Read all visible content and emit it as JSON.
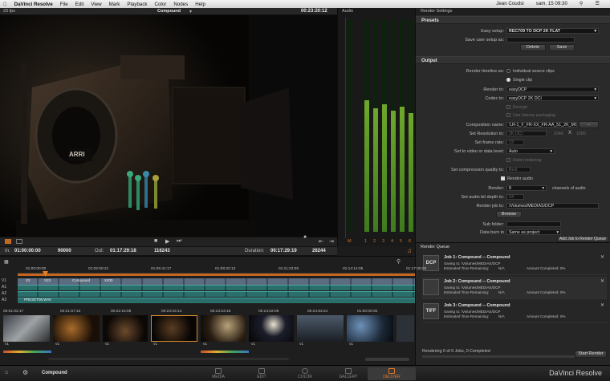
{
  "menubar": {
    "app": "DaVinci Resolve",
    "items": [
      "File",
      "Edit",
      "View",
      "Mark",
      "Playback",
      "Color",
      "Nodes",
      "Help"
    ],
    "user": "Jean Coudsi",
    "clock": "sam. 15 09:30"
  },
  "viewer": {
    "fps": "23 fps",
    "clip_name": "Compound",
    "timecode": "00:23:20:12"
  },
  "tcbar": {
    "in_label": "In:",
    "in_tc": "01:00:00:00",
    "in_frames": "90000",
    "out_label": "Out:",
    "out_tc": "01:17:29:18",
    "out_frames": "116243",
    "dur_label": "Duration:",
    "dur_tc": "00:17:29:19",
    "dur_frames": "26244"
  },
  "audio": {
    "title": "Audio",
    "levels": [
      0.62,
      0.58,
      0.6,
      0.57,
      0.59,
      0.56
    ],
    "channel_labels": [
      "M",
      "1",
      "2",
      "3",
      "4",
      "5",
      "6"
    ]
  },
  "render_settings": {
    "title": "Render Settings",
    "presets_header": "Presets",
    "easy_setup_label": "Easy setup:",
    "easy_setup_value": "REC709 TO DCP 2K FLAT",
    "save_user_label": "Save user setup as:",
    "delete_label": "Delete",
    "save_label": "Save",
    "output_header": "Output",
    "render_timeline_label": "Render timeline as:",
    "individual_clips": "Individual source clips",
    "single_clip": "Single clip",
    "render_to_label": "Render to:",
    "render_to_value": "easyDCP",
    "codec_label": "Codec to:",
    "codec_value": "easyDCP 2K DCI",
    "encrypt": "Encrypt",
    "interop": "Use Interop packaging",
    "comp_name_label": "Composition name:",
    "comp_name_value": "'LR-1_F_FR-XX_FR-AA_51_2K_MOM_CE",
    "browse_dots": "...",
    "resolution_label": "Set Resolution to:",
    "resolution_value": "2K DCI",
    "res_w": "2048",
    "res_x": "X",
    "res_h": "1080",
    "frame_rate_label": "Set frame rate:",
    "frame_rate_value": "23",
    "video_level_label": "Set to video or data level:",
    "video_level_value": "Auto",
    "field_rendering": "Field rendering",
    "compression_label": "Set compression quality to:",
    "compression_value": "Best",
    "render_audio": "Render audio",
    "render_label": "Render:",
    "render_channels": "8",
    "channels_of_audio": "channels of audio",
    "bit_depth_label": "Set audio bit depth to:",
    "bit_depth_value": "24",
    "render_job_label": "Render job to:",
    "render_job_value": "/Volumes/MEDIAS/DCP",
    "browse_label": "Browse",
    "subfolder_label": "Sub folder:",
    "data_burn_label": "Data burn in",
    "data_burn_value": "Same as project",
    "add_job": "Add Job to Render Queue"
  },
  "render_queue": {
    "title": "Render Queue",
    "jobs": [
      {
        "icon": "DCP",
        "title": "Job 1: Compound -- Compound",
        "saving": "Saving to: /Volumes/MEDIAS/DCP",
        "etr": "Estimated Time Remaining:",
        "etr_val": "N/A",
        "amount": "Amount Completed: 0%"
      },
      {
        "icon": "",
        "title": "Job 2: Compound -- Compound",
        "saving": "Saving to: /Volumes/MEDIAS/DCP",
        "etr": "Estimated Time Remaining:",
        "etr_val": "N/A",
        "amount": "Amount Completed: 0%"
      },
      {
        "icon": "TIFF",
        "title": "Job 3: Compound -- Compound",
        "saving": "Saving to: /Volumes/MEDIAS/DCP",
        "etr": "Estimated Time Remaining:",
        "etr_val": "N/A",
        "amount": "Amount Completed: 0%"
      }
    ],
    "status": "Rendering 0 of 0 Jobs, 0 Completed",
    "start_label": "Start Render"
  },
  "timeline": {
    "ruler": [
      "01:00:00:00",
      "01:02:50:21",
      "01:05:41:17",
      "01:08:32:13",
      "01:11:23:09",
      "01:14:14:05",
      "01:17:05:00"
    ],
    "tracks": [
      "V1",
      "A1",
      "A2",
      "A3"
    ],
    "audio_clip": "PRESET06.WAV",
    "clip_tcs": [
      "00:01:02:17",
      "00:21:57:10",
      "00:22:15:09",
      "00:23:03:14",
      "00:23:23:18",
      "00:24:02:09",
      "00:24:53:24",
      "01:00:00:00"
    ],
    "clip_label": "v1",
    "clip_tags": [
      "Compound",
      "X200",
      "X23",
      "X2"
    ]
  },
  "pages_bar": {
    "project": "Compound",
    "pages": [
      "MEDIA",
      "EDIT",
      "COLOR",
      "GALLERY",
      "DELIVER"
    ],
    "active": "DELIVER",
    "brand": "DaVinci Resolve"
  }
}
